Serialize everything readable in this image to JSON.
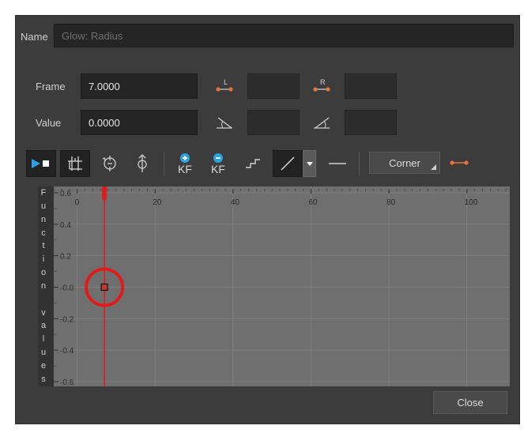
{
  "name": {
    "label": "Name",
    "value": "Glow: Radius"
  },
  "frame": {
    "label": "Frame",
    "value": "7.0000"
  },
  "value_field": {
    "label": "Value",
    "value": "0.0000"
  },
  "handles": {
    "left_letter": "L",
    "right_letter": "R"
  },
  "toolbar": {
    "add_kf_text": "KF",
    "remove_kf_text": "KF",
    "corner_label": "Corner"
  },
  "graph": {
    "vertical_label": [
      "F",
      "u",
      "n",
      "c",
      "t",
      "i",
      "o",
      "n",
      " ",
      "v",
      "a",
      "l",
      "u",
      "e",
      "s"
    ],
    "x_ticks": [
      "0",
      "20",
      "40",
      "60",
      "80",
      "100"
    ],
    "y_ticks": [
      "0.6",
      "0.4",
      "0.2",
      "-0.0",
      "-0.2",
      "-0.4",
      "-0.6"
    ]
  },
  "chart_data": {
    "type": "line",
    "x_tick_values": [
      0,
      20,
      40,
      60,
      80,
      100
    ],
    "y_tick_values": [
      0.6,
      0.4,
      0.2,
      0.0,
      -0.2,
      -0.4,
      -0.6
    ],
    "xlim": [
      -6,
      111
    ],
    "ylim": [
      -0.63,
      0.64
    ],
    "grid": true,
    "current_frame": 7,
    "keyframe": {
      "x": 7,
      "y": 0.0
    }
  },
  "close_label": "Close",
  "colors": {
    "accent_orange": "#e8743b",
    "accent_blue": "#2aa3e6",
    "playhead_red": "#e01b1b"
  }
}
